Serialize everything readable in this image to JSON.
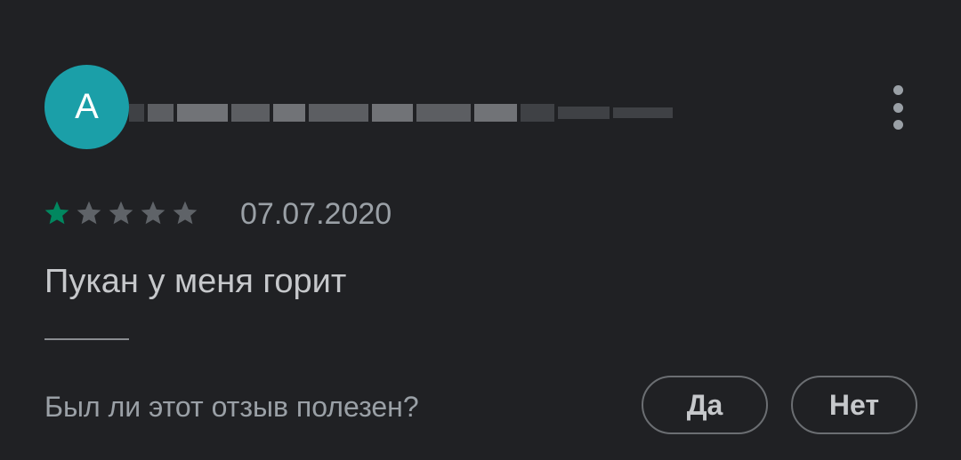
{
  "review": {
    "avatar_letter": "A",
    "author_name_redacted": true,
    "rating": 1,
    "rating_max": 5,
    "date": "07.07.2020",
    "text": "Пукан у меня горит"
  },
  "helpful": {
    "question": "Был ли этот отзыв полезен?",
    "yes_label": "Да",
    "no_label": "Нет"
  },
  "colors": {
    "avatar_bg": "#1b9fa8",
    "star_filled": "#01875f",
    "star_empty": "#5f6368",
    "background": "#202124"
  },
  "icons": {
    "more": "more-vert-icon",
    "star": "star-icon"
  }
}
